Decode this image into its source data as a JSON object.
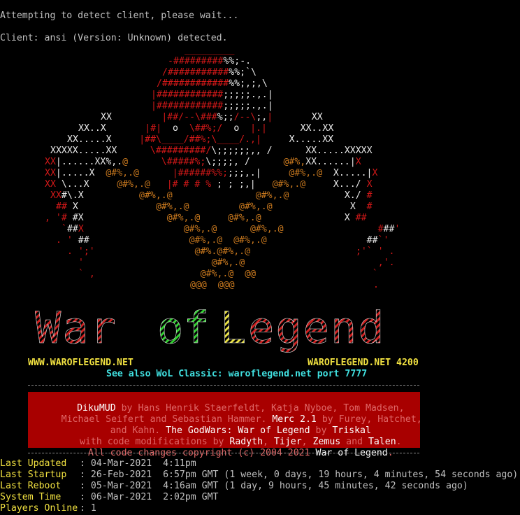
{
  "terminal": {
    "detect_line": "Attempting to detect client, please wait...",
    "client_line": "Client: ansi (Version: Unknown) detected."
  },
  "links": {
    "left_url": "WWW.WAROFLEGEND.NET",
    "right_addr": "WAROFLEGEND.NET 4200",
    "classic_line": "See also WoL Classic: waroflegend.net port 7777"
  },
  "credits": {
    "line1": [
      "DikuMUD",
      " by ",
      "Hans Henrik Staerfeldt, Katja Nyboe, Tom Madsen,"
    ],
    "line2": [
      "Michael Seifert and Sebastian Hammer. ",
      "Merc 2.1",
      " by Furey, Hatchet,"
    ],
    "line3": [
      "and Kahn. ",
      "The GodWars: War of Legend",
      " by ",
      "Triskal"
    ],
    "line4": [
      "with code modifications by ",
      "Radyth",
      ", ",
      "Tijer",
      ", ",
      "Zemus",
      " and ",
      "Talen",
      "."
    ],
    "line5": [
      "All code changes copyright (c) 2004-2021 ",
      "War of Legend",
      "."
    ]
  },
  "stats": [
    {
      "label": "Last Updated",
      "value": ": 04-Mar-2021  4:11pm"
    },
    {
      "label": "Last Startup",
      "value": ": 26-Feb-2021  6:57pm GMT (1 week, 0 days, 19 hours, 4 minutes, 54 seconds ago)"
    },
    {
      "label": "Last Reboot",
      "value": ": 05-Mar-2021  4:16am GMT (1 day, 9 hours, 45 minutes, 42 seconds ago)"
    },
    {
      "label": "System Time",
      "value": ": 06-Mar-2021  2:02pm GMT"
    },
    {
      "label": "Players Online",
      "value": ": 1"
    }
  ],
  "logo_text": "War of Legend",
  "colors": {
    "banner": "#a80000",
    "highlight": "#f0e040",
    "link": "#40e0e0",
    "art_red": "#d01818",
    "art_orange": "#c8781e"
  }
}
